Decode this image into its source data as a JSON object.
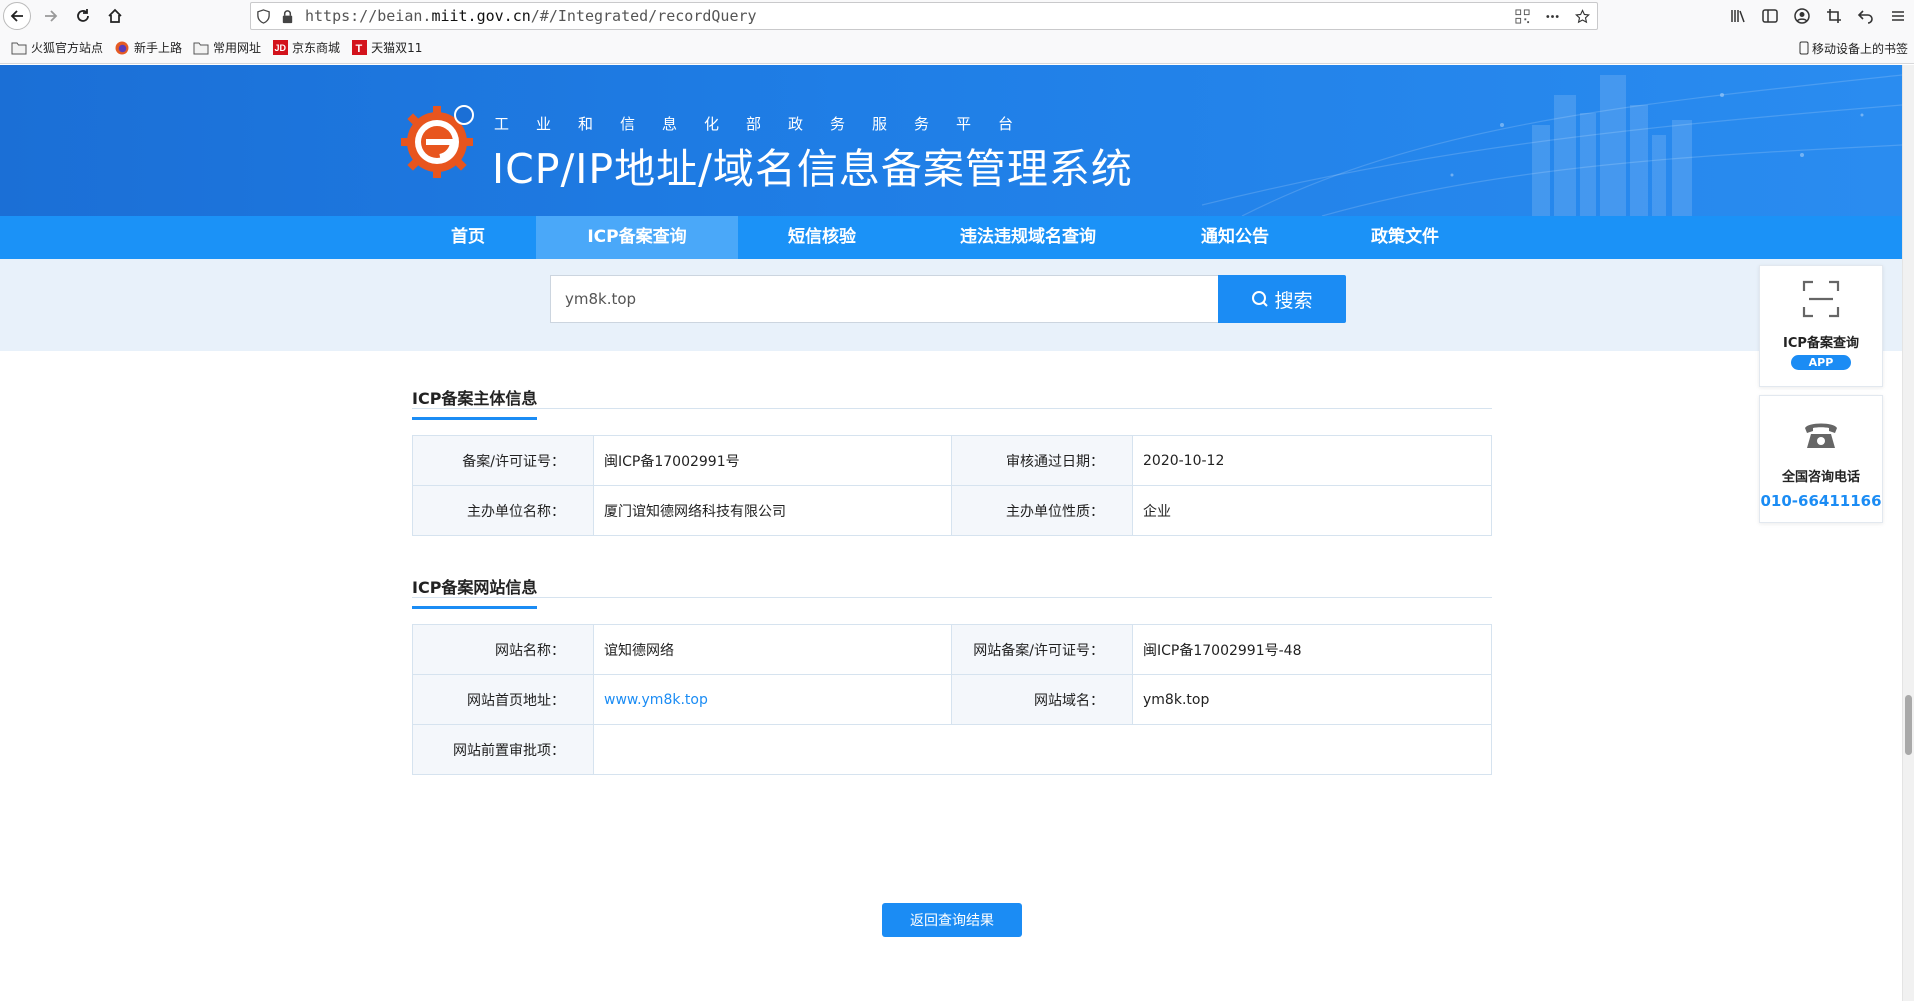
{
  "browser": {
    "url_prefix": "https://beian.",
    "url_domain": "miit.gov.cn",
    "url_suffix": "/#/Integrated/recordQuery",
    "bookmarks": [
      {
        "label": "火狐官方站点",
        "icon": "folder-icon"
      },
      {
        "label": "新手上路",
        "icon": "firefox-icon"
      },
      {
        "label": "常用网址",
        "icon": "folder-icon"
      },
      {
        "label": "京东商城",
        "icon": "jd-icon"
      },
      {
        "label": "天猫双11",
        "icon": "tmall-icon"
      }
    ],
    "mobile_bookmarks": "移动设备上的书签"
  },
  "banner": {
    "subtitle": "工业和信息化部政务服务平台",
    "title": "ICP/IP地址/域名信息备案管理系统"
  },
  "nav": {
    "items": [
      {
        "label": "首页"
      },
      {
        "label": "ICP备案查询"
      },
      {
        "label": "短信核验"
      },
      {
        "label": "违法违规域名查询"
      },
      {
        "label": "通知公告"
      },
      {
        "label": "政策文件"
      }
    ],
    "active_index": 1
  },
  "search": {
    "value": "ym8k.top",
    "button_label": "搜索"
  },
  "subject": {
    "title": "ICP备案主体信息",
    "license_label": "备案/许可证号：",
    "license_value": "闽ICP备17002991号",
    "date_label": "审核通过日期：",
    "date_value": "2020-10-12",
    "org_label": "主办单位名称：",
    "org_value": "厦门谊知德网络科技有限公司",
    "nature_label": "主办单位性质：",
    "nature_value": "企业"
  },
  "website": {
    "title": "ICP备案网站信息",
    "name_label": "网站名称：",
    "name_value": "谊知德网络",
    "license_label": "网站备案/许可证号：",
    "license_value": "闽ICP备17002991号-48",
    "home_label": "网站首页地址：",
    "home_value": "www.ym8k.top",
    "domain_label": "网站域名：",
    "domain_value": "ym8k.top",
    "preapproval_label": "网站前置审批项：",
    "preapproval_value": ""
  },
  "back_button": "返回查询结果",
  "side": {
    "app_title": "ICP备案查询",
    "app_badge": "APP",
    "phone_title": "全国咨询电话",
    "phone_number": "010-66411166"
  },
  "colors": {
    "primary": "#1b8cf4",
    "nav": "#1b92f7",
    "nav_active": "#4aa8f9",
    "banner": "#1f7ee6"
  }
}
